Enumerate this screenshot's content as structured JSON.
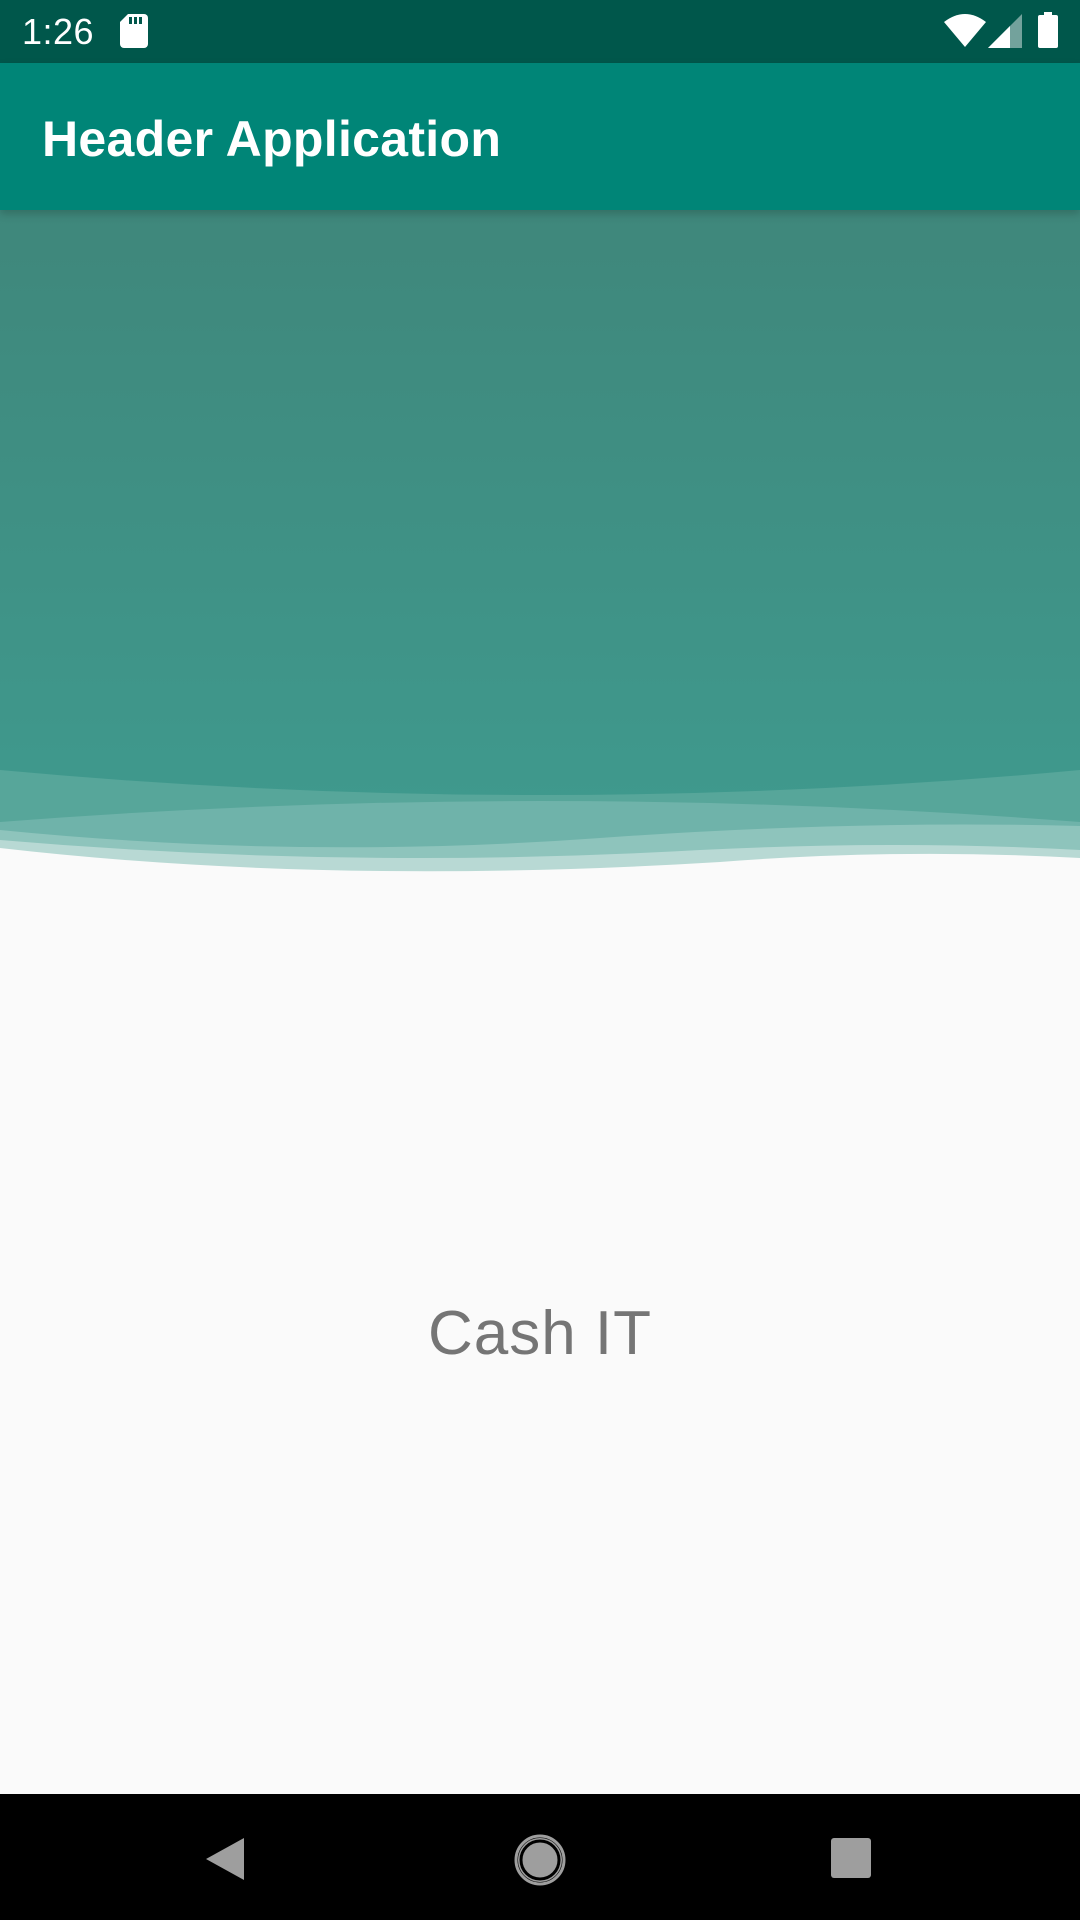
{
  "status_bar": {
    "time": "1:26",
    "icons": [
      "sd-card-icon",
      "wifi-icon",
      "cell-signal-icon",
      "battery-icon"
    ]
  },
  "app_bar": {
    "title": "Header Application"
  },
  "main": {
    "center_text": "Cash IT"
  },
  "nav_bar": {
    "icons": [
      "back-icon",
      "home-icon",
      "recents-icon"
    ]
  },
  "colors": {
    "status_bar": "#00574b",
    "app_bar": "#008577",
    "header_gradient_top": "#3f877b",
    "header_gradient_bottom": "#3f998d",
    "background": "#fafafa",
    "center_text": "#757575",
    "nav_bar": "#000000"
  }
}
